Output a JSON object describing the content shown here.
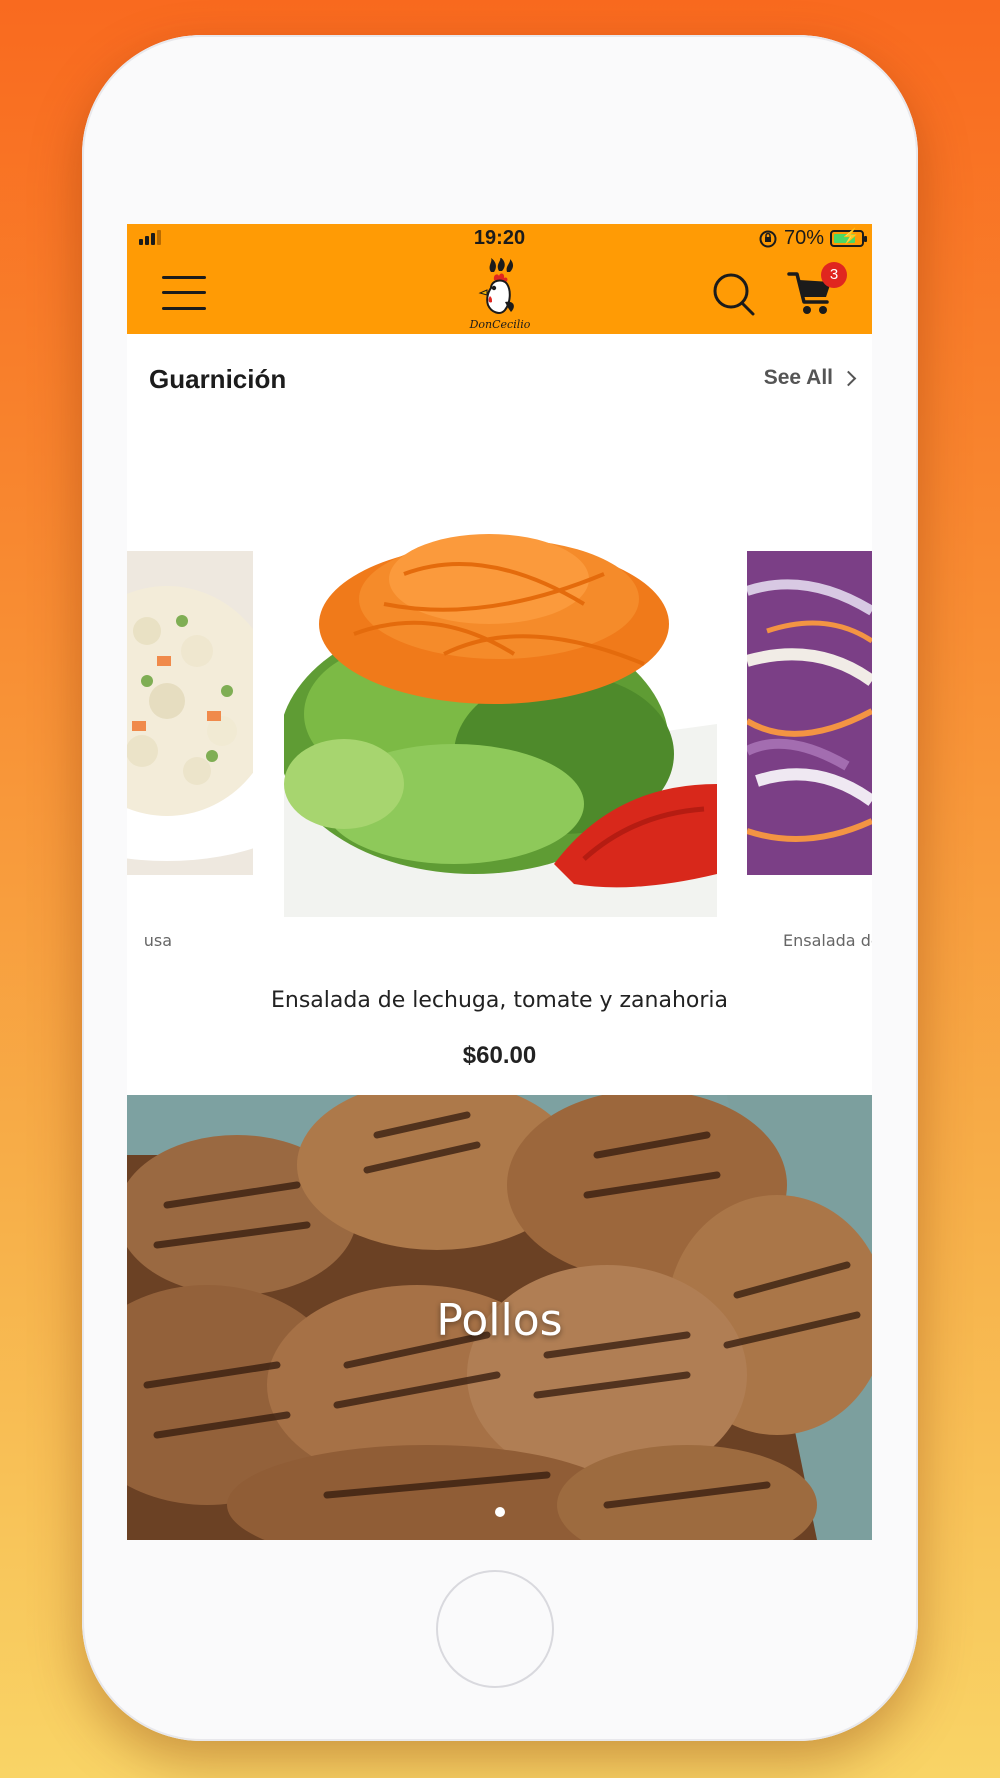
{
  "status_bar": {
    "time": "19:20",
    "battery": "70%",
    "battery_level": 0.7
  },
  "nav": {
    "logo_text": "DonCecilio",
    "cart_count": "3"
  },
  "section": {
    "title": "Guarnición",
    "see_all": "See All"
  },
  "carousel": {
    "left_label": "usa",
    "right_label": "Ensalada de",
    "main": {
      "name": "Ensalada de lechuga, tomate y zanahoria",
      "price": "$60.00"
    }
  },
  "banner": {
    "title": "Pollos",
    "page_count": 1,
    "active_page": 1
  },
  "colors": {
    "brand": "#ff9b05",
    "badge": "#e0261f",
    "background_top": "#f96a1f",
    "background_bottom": "#f9d466"
  },
  "icons": [
    "signal-icon",
    "orientation-lock-icon",
    "battery-icon",
    "menu-icon",
    "rooster-logo",
    "search-icon",
    "cart-icon",
    "chevron-right-icon"
  ]
}
